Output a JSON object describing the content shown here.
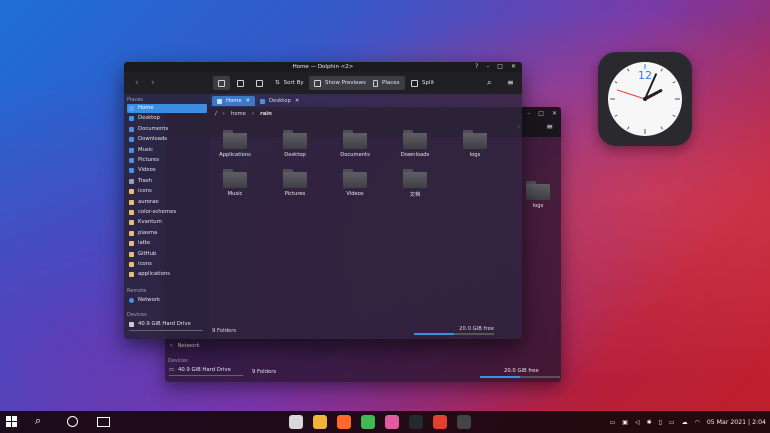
{
  "window": {
    "title": "Home — Dolphin <2>",
    "controls": [
      "?",
      "–",
      "□",
      "✕"
    ]
  },
  "toolbar": {
    "sort_label": "Sort By",
    "previews_label": "Show Previews",
    "places_label": "Places",
    "split_label": "Split"
  },
  "sidebar": {
    "places_heading": "Places",
    "places": [
      {
        "label": "Home",
        "color": "#5aa0ff",
        "selected": true
      },
      {
        "label": "Desktop",
        "color": "#4a90e2"
      },
      {
        "label": "Documents",
        "color": "#4a90e2"
      },
      {
        "label": "Downloads",
        "color": "#4a90e2"
      },
      {
        "label": "Music",
        "color": "#4a90e2"
      },
      {
        "label": "Pictures",
        "color": "#4a90e2"
      },
      {
        "label": "Videos",
        "color": "#4a90e2"
      },
      {
        "label": "Trash",
        "color": "#9aa0aa"
      },
      {
        "label": "icons",
        "color": "#e6c07b"
      },
      {
        "label": "aurorae",
        "color": "#e6c07b"
      },
      {
        "label": "color-schemes",
        "color": "#e6c07b"
      },
      {
        "label": "Kvantum",
        "color": "#e6c07b"
      },
      {
        "label": "plasma",
        "color": "#e6c07b"
      },
      {
        "label": "latte",
        "color": "#e6c07b"
      },
      {
        "label": "GitHub",
        "color": "#e6c07b"
      },
      {
        "label": "icons",
        "color": "#e6c07b"
      },
      {
        "label": "applications",
        "color": "#e6c07b"
      }
    ],
    "remote_heading": "Remote",
    "remote": [
      {
        "label": "Network"
      }
    ],
    "devices_heading": "Devices",
    "devices": [
      {
        "label": "40.9 GiB Hard Drive"
      }
    ]
  },
  "tabs": [
    {
      "label": "Home",
      "active": true
    },
    {
      "label": "Desktop",
      "active": false
    }
  ],
  "breadcrumb": [
    "/",
    "home",
    "rain"
  ],
  "files": [
    {
      "label": "Applications"
    },
    {
      "label": "Desktop"
    },
    {
      "label": "Documents"
    },
    {
      "label": "Downloads"
    },
    {
      "label": "logs"
    },
    {
      "label": "Music"
    },
    {
      "label": "Pictures"
    },
    {
      "label": "Videos"
    },
    {
      "label": "文档"
    }
  ],
  "status": {
    "count": "9 Folders",
    "free": "20.0 GiB free",
    "used_fraction": 0.5
  },
  "back_window": {
    "network": "Network",
    "devices_heading": "Devices",
    "drive": "40.9 GiB Hard Drive",
    "count": "9 Folders",
    "free": "20.0 GiB free",
    "logs": "logs"
  },
  "clock": {
    "hour": 2,
    "minute": 4,
    "second": 48,
    "twelve": "12"
  },
  "taskbar": {
    "datetime": "05 Mar 2021 | 2:04",
    "apps": [
      "files",
      "firefox",
      "phone",
      "store",
      "github",
      "music",
      "inkscape"
    ]
  }
}
